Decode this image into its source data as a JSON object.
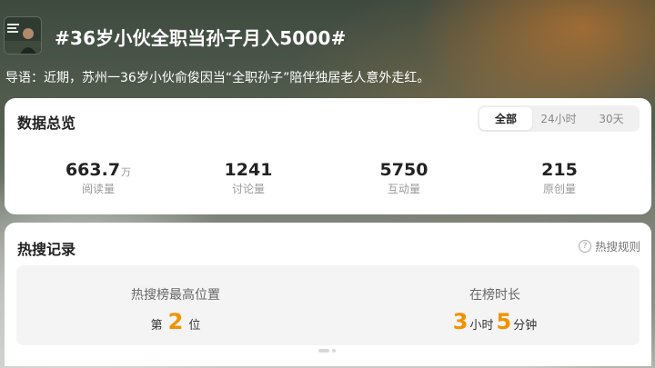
{
  "header": {
    "topic_title": "#36岁小伙全职当孙子月入5000#",
    "intro": "导语：近期，苏州一36岁小伙俞俊因当“全职孙子”陪伴独居老人意外走红。"
  },
  "overview": {
    "title": "数据总览",
    "tabs": [
      {
        "label": "全部",
        "active": true
      },
      {
        "label": "24小时",
        "active": false
      },
      {
        "label": "30天",
        "active": false
      }
    ],
    "stats": [
      {
        "value": "663.7",
        "unit": "万",
        "label": "阅读量"
      },
      {
        "value": "1241",
        "unit": "",
        "label": "讨论量"
      },
      {
        "value": "5750",
        "unit": "",
        "label": "互动量"
      },
      {
        "value": "215",
        "unit": "",
        "label": "原创量"
      }
    ]
  },
  "hot_record": {
    "title": "热搜记录",
    "rules_label": "热搜规则",
    "rules_icon": "?",
    "peak": {
      "label": "热搜榜最高位置",
      "prefix": "第",
      "value": "2",
      "suffix": "位"
    },
    "duration": {
      "label": "在榜时长",
      "hours": "3",
      "hours_unit": "小时",
      "minutes": "5",
      "minutes_unit": "分钟"
    }
  },
  "colors": {
    "accent": "#f39200"
  }
}
